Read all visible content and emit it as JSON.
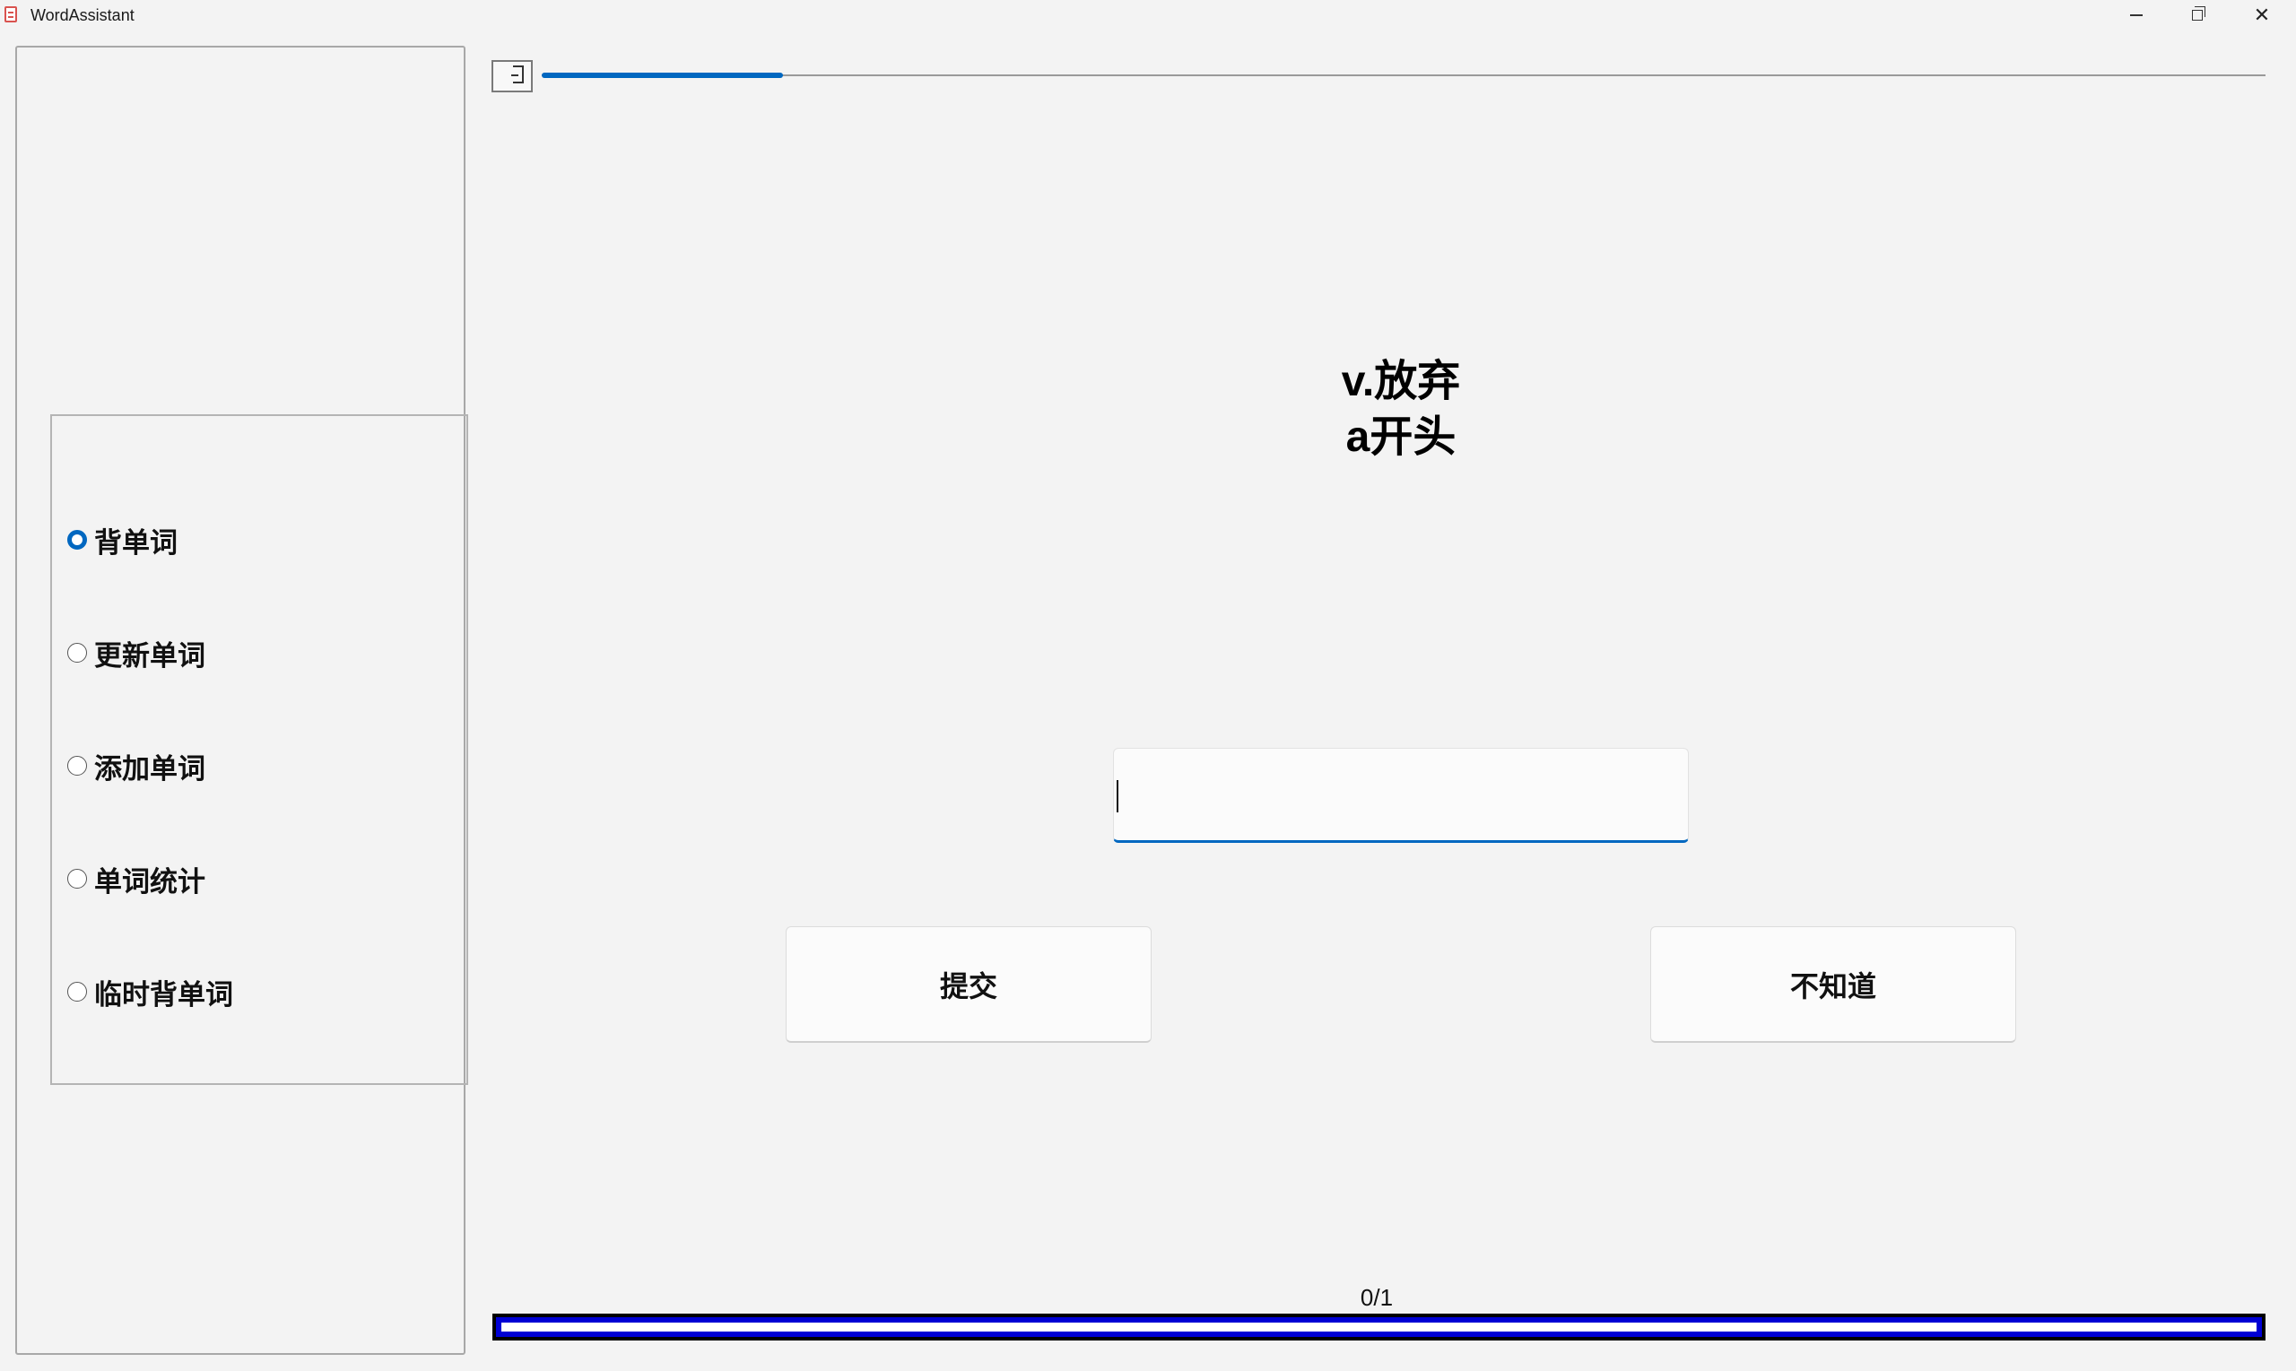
{
  "window": {
    "title": "WordAssistant",
    "minimize_glyph": "",
    "maximize_glyph": "",
    "close_glyph": "✕"
  },
  "sidebar": {
    "options": [
      {
        "label": "背单词",
        "checked": true
      },
      {
        "label": "更新单词",
        "checked": false
      },
      {
        "label": "添加单词",
        "checked": false
      },
      {
        "label": "单词统计",
        "checked": false
      },
      {
        "label": "临时背单词",
        "checked": false
      }
    ]
  },
  "top_progress": {
    "value": 0.14
  },
  "question": {
    "meaning": "v.放弃",
    "hint": "a开头"
  },
  "answer": {
    "value": "",
    "placeholder": ""
  },
  "buttons": {
    "submit": "提交",
    "dont_know": "不知道"
  },
  "progress": {
    "text": "0/1",
    "completed": 0,
    "total": 1,
    "bar_color": "#0000d4"
  },
  "colors": {
    "accent": "#0067c0"
  }
}
